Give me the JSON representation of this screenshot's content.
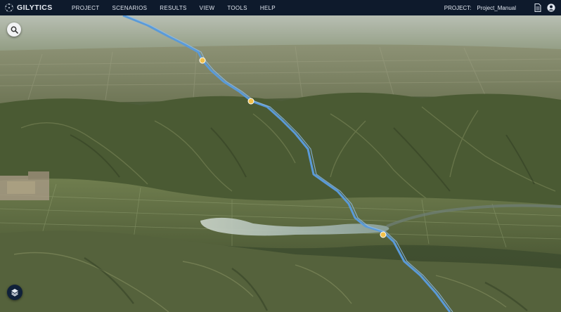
{
  "app": {
    "brand": "GILYTICS",
    "menu": [
      "PROJECT",
      "SCENARIOS",
      "RESULTS",
      "VIEW",
      "TOOLS",
      "HELP"
    ],
    "project_label": "PROJECT:",
    "project_name": "Project_Manual",
    "icons": {
      "logo": "network-globe-icon",
      "document": "document-icon",
      "account": "account-icon",
      "search": "search-icon",
      "layers": "layers-icon"
    }
  },
  "map": {
    "view": "3D satellite terrain",
    "route_color": "#5a9ad8",
    "marker_color": "#f1c04a",
    "marker_count": 3
  }
}
